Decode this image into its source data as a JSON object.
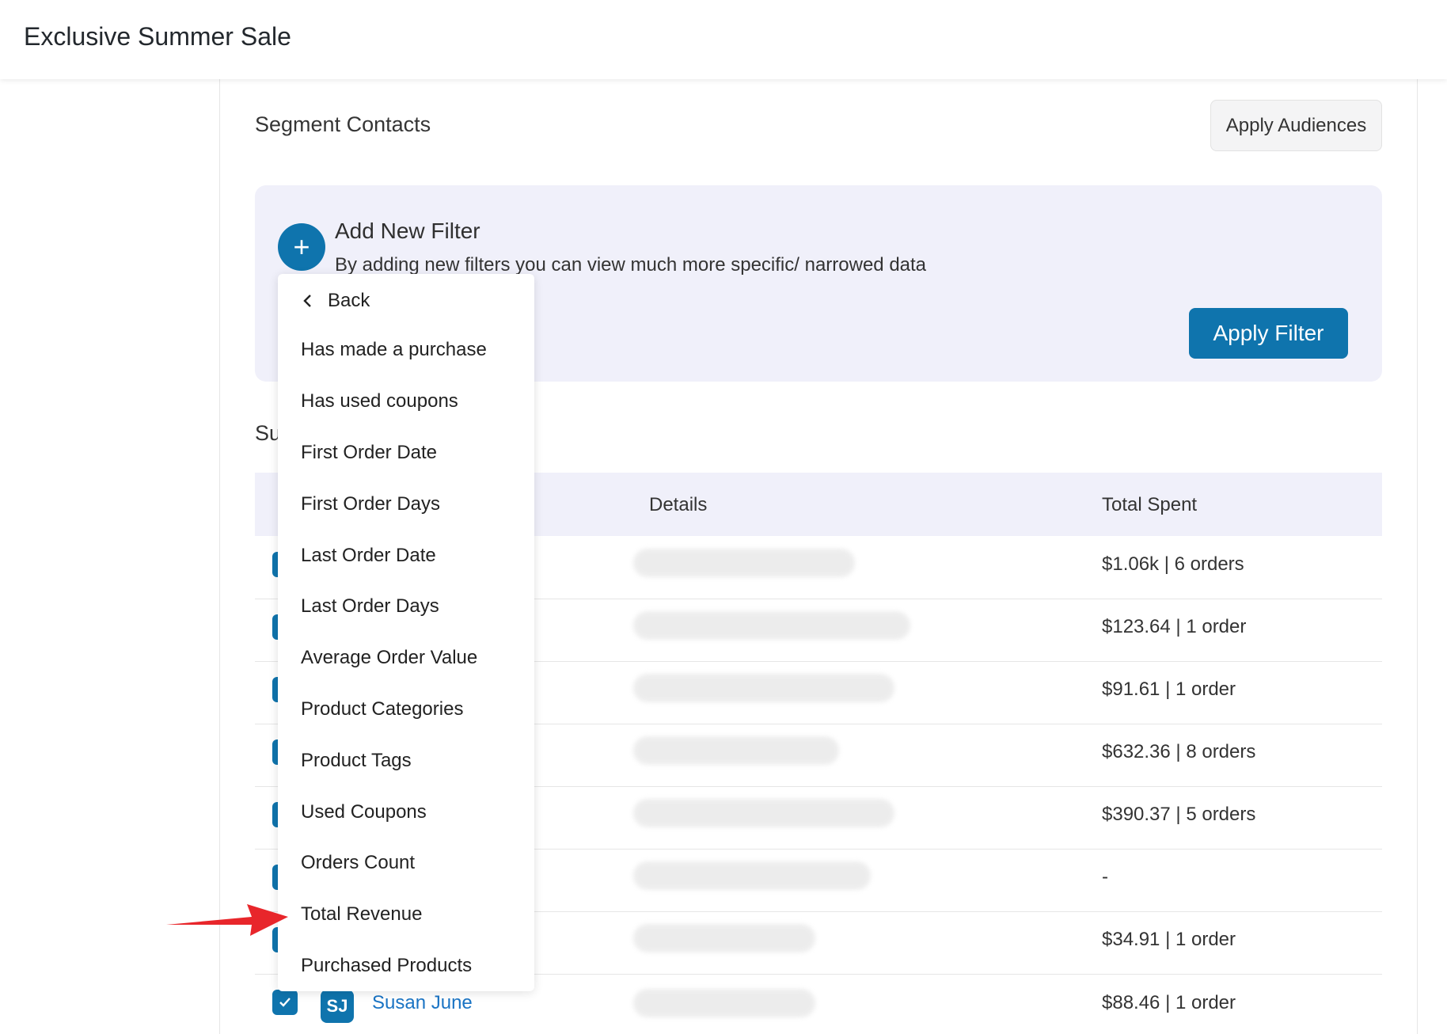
{
  "header": {
    "title": "Exclusive Summer Sale"
  },
  "segment": {
    "title": "Segment Contacts",
    "apply_audiences_label": "Apply Audiences"
  },
  "filter": {
    "plus_symbol": "+",
    "title": "Add New Filter",
    "subtitle": "By adding new filters you can view much more specific/ narrowed data",
    "apply_label": "Apply Filter"
  },
  "subscribers": {
    "heading_partial": "Su"
  },
  "table": {
    "headers": {
      "details": "Details",
      "total_spent": "Total Spent"
    },
    "rows": [
      {
        "total_spent": "$1.06k | 6 orders"
      },
      {
        "total_spent": "$123.64 | 1 order"
      },
      {
        "total_spent": "$91.61 | 1 order"
      },
      {
        "total_spent": "$632.36 | 8 orders"
      },
      {
        "total_spent": "$390.37 | 5 orders"
      },
      {
        "total_spent": "-"
      },
      {
        "total_spent": "$34.91 | 1 order"
      },
      {
        "initials": "SJ",
        "name": "Susan June",
        "total_spent": "$88.46 | 1 order"
      }
    ]
  },
  "dropdown": {
    "back_label": "Back",
    "items": [
      "Has made a purchase",
      "Has used coupons",
      "First Order Date",
      "First Order Days",
      "Last Order Date",
      "Last Order Days",
      "Average Order Value",
      "Product Categories",
      "Product Tags",
      "Used Coupons",
      "Orders Count",
      "Total Revenue",
      "Purchased Products"
    ]
  },
  "colors": {
    "accent": "#0f74ad",
    "link": "#1a74c4",
    "panel": "#f0f0fa",
    "annotation_arrow": "#e8262b"
  },
  "icons": {
    "back": "chevron-left-icon",
    "add": "plus-icon",
    "check": "checkmark-icon",
    "annotation": "red-arrow-icon"
  }
}
